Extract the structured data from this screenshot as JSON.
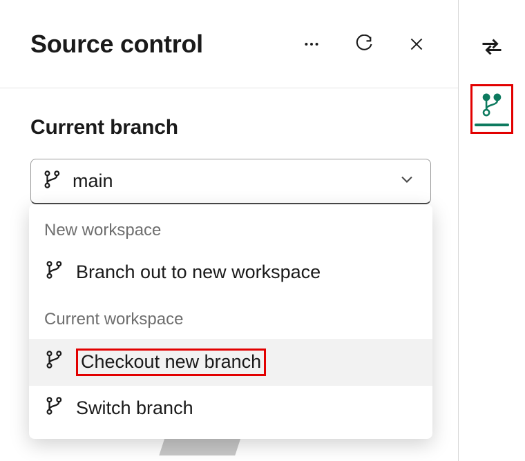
{
  "header": {
    "title": "Source control",
    "actions": {
      "more": "more-icon",
      "refresh": "refresh-icon",
      "close": "close-icon"
    }
  },
  "branch_section": {
    "label": "Current branch",
    "selected": "main"
  },
  "menu": {
    "group1_label": "New workspace",
    "group1_items": [
      {
        "label": "Branch out to new workspace"
      }
    ],
    "group2_label": "Current workspace",
    "group2_items": [
      {
        "label": "Checkout new branch",
        "highlighted": true,
        "boxed": true
      },
      {
        "label": "Switch branch"
      }
    ]
  },
  "rail": {
    "sync": "sync-icon",
    "source_control": "source-control-icon"
  },
  "colors": {
    "accent_green": "#0d7a5f",
    "highlight_red": "#e20000"
  }
}
